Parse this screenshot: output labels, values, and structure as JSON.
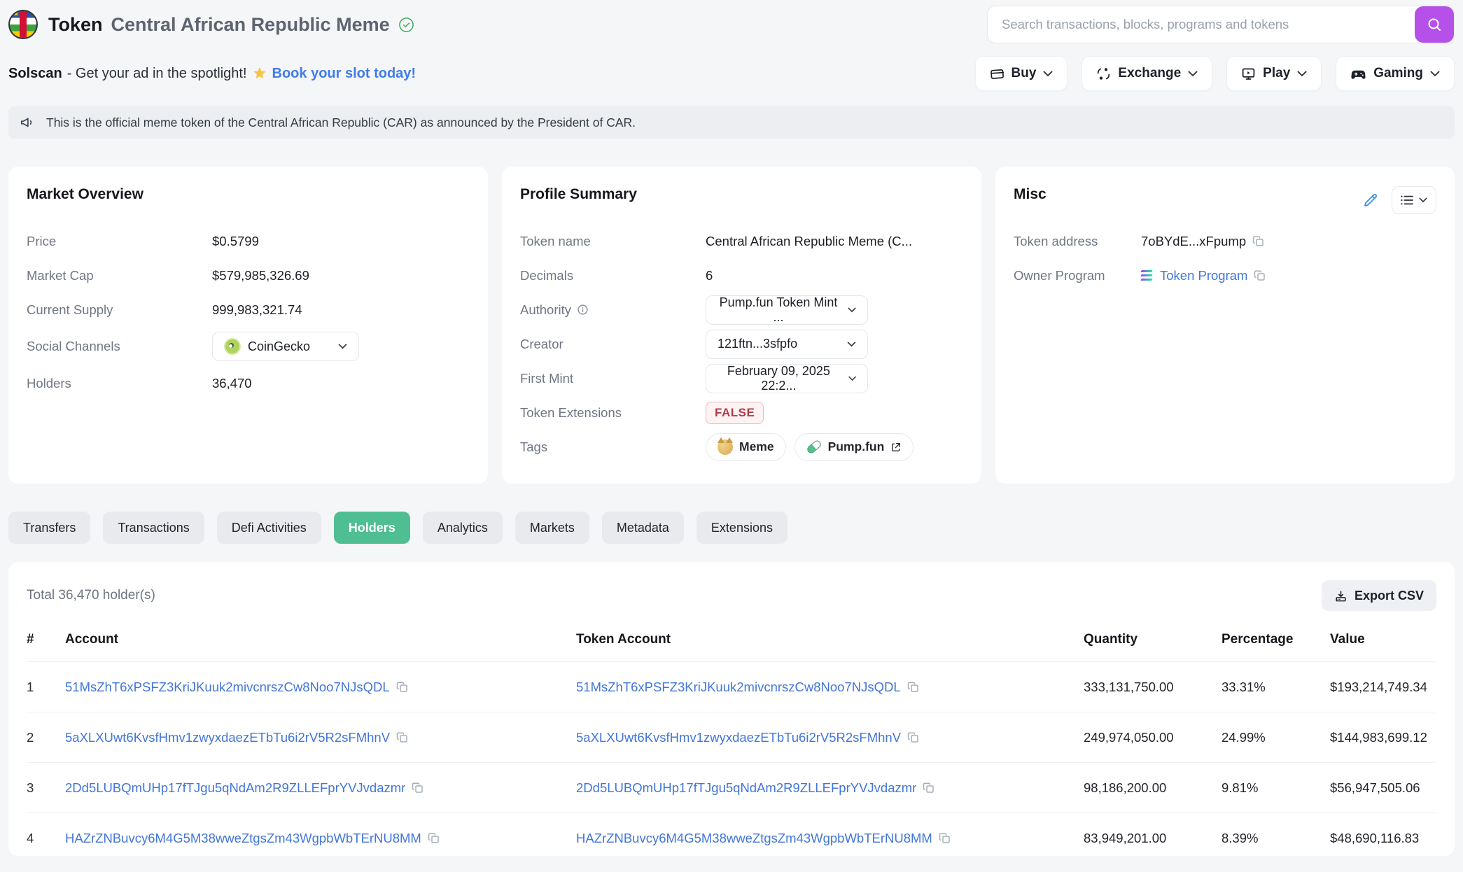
{
  "header": {
    "title_prefix": "Token",
    "title_name": "Central African Republic Meme",
    "search_placeholder": "Search transactions, blocks, programs and tokens",
    "nav_buttons": [
      {
        "label": "Buy",
        "icon": "credit-card"
      },
      {
        "label": "Exchange",
        "icon": "swap"
      },
      {
        "label": "Play",
        "icon": "monitor-play"
      },
      {
        "label": "Gaming",
        "icon": "gamepad"
      }
    ]
  },
  "ad": {
    "brand": "Solscan",
    "middle": "- Get your ad in the spotlight!",
    "link": "Book your slot today!"
  },
  "announcement": "This is the official meme token of the Central African Republic (CAR) as announced by the President of CAR.",
  "market_overview": {
    "title": "Market Overview",
    "price_label": "Price",
    "price": "$0.5799",
    "market_cap_label": "Market Cap",
    "market_cap": "$579,985,326.69",
    "supply_label": "Current Supply",
    "supply": "999,983,321.74",
    "social_label": "Social Channels",
    "social_value": "CoinGecko",
    "holders_label": "Holders",
    "holders": "36,470"
  },
  "profile_summary": {
    "title": "Profile Summary",
    "token_name_label": "Token name",
    "token_name": "Central African Republic Meme (C...",
    "decimals_label": "Decimals",
    "decimals": "6",
    "authority_label": "Authority",
    "authority": "Pump.fun Token Mint ...",
    "creator_label": "Creator",
    "creator": "121ftn...3sfpfo",
    "first_mint_label": "First Mint",
    "first_mint": "February 09, 2025 22:2...",
    "extensions_label": "Token Extensions",
    "extensions_value": "FALSE",
    "tags_label": "Tags",
    "tags": [
      {
        "label": "Meme"
      },
      {
        "label": "Pump.fun"
      }
    ]
  },
  "misc": {
    "title": "Misc",
    "address_label": "Token address",
    "address": "7oBYdE...xFpump",
    "owner_label": "Owner Program",
    "owner": "Token Program"
  },
  "tabs": [
    {
      "label": "Transfers",
      "active": false
    },
    {
      "label": "Transactions",
      "active": false
    },
    {
      "label": "Defi Activities",
      "active": false
    },
    {
      "label": "Holders",
      "active": true
    },
    {
      "label": "Analytics",
      "active": false
    },
    {
      "label": "Markets",
      "active": false
    },
    {
      "label": "Metadata",
      "active": false
    },
    {
      "label": "Extensions",
      "active": false
    }
  ],
  "holders_table": {
    "total": "Total 36,470 holder(s)",
    "export_label": "Export CSV",
    "columns": [
      "#",
      "Account",
      "Token Account",
      "Quantity",
      "Percentage",
      "Value"
    ],
    "rows": [
      {
        "rank": "1",
        "account": "51MsZhT6xPSFZ3KriJKuuk2mivcnrszCw8Noo7NJsQDL",
        "token_account": "51MsZhT6xPSFZ3KriJKuuk2mivcnrszCw8Noo7NJsQDL",
        "quantity": "333,131,750.00",
        "percentage": "33.31%",
        "value": "$193,214,749.34"
      },
      {
        "rank": "2",
        "account": "5aXLXUwt6KvsfHmv1zwyxdaezETbTu6i2rV5R2sFMhnV",
        "token_account": "5aXLXUwt6KvsfHmv1zwyxdaezETbTu6i2rV5R2sFMhnV",
        "quantity": "249,974,050.00",
        "percentage": "24.99%",
        "value": "$144,983,699.12"
      },
      {
        "rank": "3",
        "account": "2Dd5LUBQmUHp17fTJgu5qNdAm2R9ZLLEFprYVJvdazmr",
        "token_account": "2Dd5LUBQmUHp17fTJgu5qNdAm2R9ZLLEFprYVJvdazmr",
        "quantity": "98,186,200.00",
        "percentage": "9.81%",
        "value": "$56,947,505.06"
      },
      {
        "rank": "4",
        "account": "HAZrZNBuvcy6M4G5M38wweZtgsZm43WgpbWbTErNU8MM",
        "token_account": "HAZrZNBuvcy6M4G5M38wweZtgsZm43WgpbWbTErNU8MM",
        "quantity": "83,949,201.00",
        "percentage": "8.39%",
        "value": "$48,690,116.83"
      }
    ]
  },
  "colors": {
    "accent_green": "#4fbe93",
    "link_blue": "#4276d8",
    "search_purple": "#b551e9",
    "false_badge_red": "#b43a48",
    "page_bg": "#f5f6f8"
  }
}
